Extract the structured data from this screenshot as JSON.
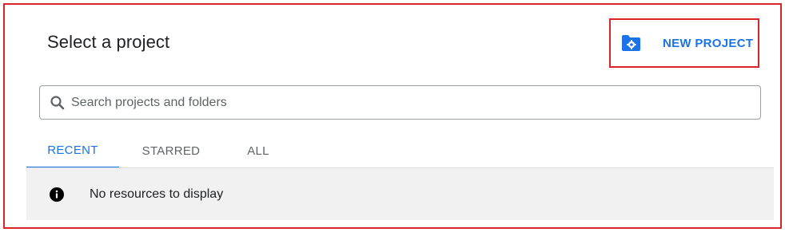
{
  "dialog": {
    "title": "Select a project",
    "new_project_label": "NEW PROJECT",
    "new_project_icon": "folder-settings-icon"
  },
  "search": {
    "placeholder": "Search projects and folders",
    "value": "",
    "icon": "search-icon"
  },
  "tabs": [
    {
      "label": "RECENT",
      "active": true
    },
    {
      "label": "STARRED",
      "active": false
    },
    {
      "label": "ALL",
      "active": false
    }
  ],
  "empty_state": {
    "icon": "info-icon",
    "message": "No resources to display"
  },
  "colors": {
    "accent": "#1a73e8",
    "highlight_border": "#d9242b",
    "panel_background": "#f1f1f1",
    "text_primary": "#202124",
    "text_secondary": "#5f6368"
  }
}
